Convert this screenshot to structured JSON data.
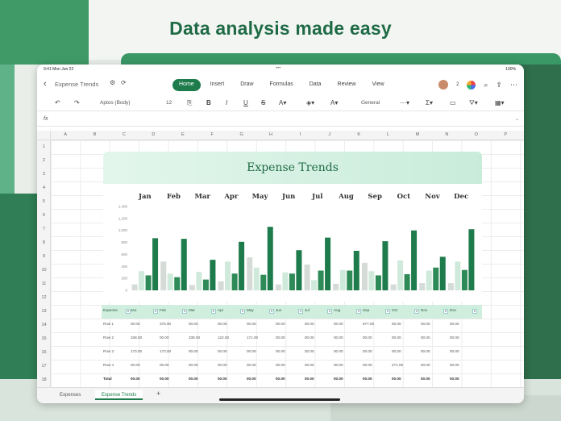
{
  "headline": "Data analysis made easy",
  "status": {
    "time": "9:41  Mon Jun 22",
    "battery": "100%"
  },
  "doc": {
    "title": "Expense Trends"
  },
  "ribbon": {
    "tabs": [
      "Home",
      "Insert",
      "Draw",
      "Formulas",
      "Data",
      "Review",
      "View"
    ],
    "active": "Home"
  },
  "toolbar": {
    "font": "Aptos (Body)",
    "font_size": "12",
    "number_format": "General"
  },
  "user": {
    "count": "2"
  },
  "columns": [
    "A",
    "B",
    "C",
    "D",
    "E",
    "F",
    "G",
    "H",
    "I",
    "J",
    "K",
    "L",
    "M",
    "N",
    "O",
    "P",
    "Q"
  ],
  "rows": [
    "1",
    "2",
    "3",
    "4",
    "5",
    "6",
    "7",
    "8",
    "9",
    "10",
    "11",
    "12",
    "13",
    "14",
    "15",
    "16",
    "17",
    "18"
  ],
  "sheets": [
    "Expenses",
    "Expense Trends"
  ],
  "colors": {
    "accent": "#1e7b4b",
    "dark": "#2e8b57",
    "light": "#cfe9db",
    "grey": "#d5dbd7"
  },
  "chart_data": {
    "type": "bar",
    "title": "Expense Trends",
    "categories": [
      "Jan",
      "Feb",
      "Mar",
      "Apr",
      "May",
      "Jun",
      "Jul",
      "Aug",
      "Sep",
      "Oct",
      "Nov",
      "Dec"
    ],
    "ylim": [
      0,
      1400
    ],
    "yticks": [
      "0",
      "200",
      "400",
      "600",
      "800",
      "1,000",
      "1,200",
      "1,400"
    ],
    "series": [
      {
        "values": [
          100,
          480,
          90,
          150,
          550,
          100,
          430,
          110,
          460,
          100,
          120,
          120
        ]
      },
      {
        "values": [
          320,
          280,
          310,
          480,
          380,
          300,
          170,
          340,
          320,
          500,
          330,
          480
        ]
      },
      {
        "values": [
          250,
          220,
          180,
          280,
          260,
          280,
          330,
          330,
          250,
          270,
          380,
          340
        ]
      },
      {
        "values": [
          870,
          860,
          510,
          810,
          1060,
          670,
          880,
          660,
          820,
          1000,
          560,
          1020
        ]
      }
    ]
  },
  "table": {
    "header": [
      "Expense",
      "Jan",
      "Feb",
      "Mar",
      "Apr",
      "May",
      "Jun",
      "Jul",
      "Aug",
      "Sep",
      "Oct",
      "Nov",
      "Dec"
    ],
    "rows": [
      [
        "Row 1",
        "00.00",
        "375.00",
        "00.00",
        "00.00",
        "00.00",
        "00.00",
        "00.00",
        "00.00",
        "577.00",
        "00.00",
        "00.00",
        "00.00"
      ],
      [
        "Row 2",
        "338.00",
        "00.00",
        "338.00",
        "122.00",
        "171.00",
        "00.00",
        "00.00",
        "00.00",
        "00.00",
        "00.00",
        "00.00",
        "00.00"
      ],
      [
        "Row 3",
        "173.00",
        "173.00",
        "00.00",
        "00.00",
        "00.00",
        "00.00",
        "00.00",
        "00.00",
        "00.00",
        "00.00",
        "00.00",
        "00.00"
      ],
      [
        "Row 4",
        "00.00",
        "00.00",
        "00.00",
        "00.00",
        "00.00",
        "00.00",
        "00.00",
        "00.00",
        "00.00",
        "271.00",
        "00.00",
        "00.00"
      ]
    ],
    "total": [
      "Total",
      "00.00",
      "00.00",
      "00.00",
      "00.00",
      "00.00",
      "00.00",
      "00.00",
      "00.00",
      "00.00",
      "00.00",
      "00.00",
      "00.00"
    ]
  }
}
